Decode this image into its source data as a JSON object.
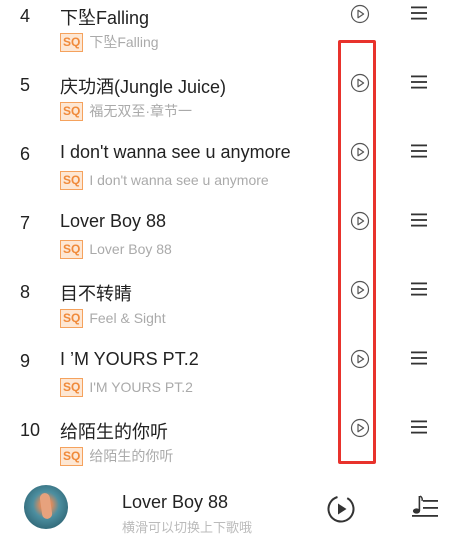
{
  "songs": [
    {
      "num": "4",
      "title": "下坠Falling",
      "quality": "SQ",
      "artist": "下坠Falling"
    },
    {
      "num": "5",
      "title": "庆功酒(Jungle Juice)",
      "quality": "SQ",
      "artist": "福无双至·章节一"
    },
    {
      "num": "6",
      "title": "I don't wanna see u anymore",
      "quality": "SQ",
      "artist": "I don't wanna see u anymore"
    },
    {
      "num": "7",
      "title": "Lover Boy 88",
      "quality": "SQ",
      "artist": "Lover Boy 88"
    },
    {
      "num": "8",
      "title": "目不转睛",
      "quality": "SQ",
      "artist": "Feel & Sight"
    },
    {
      "num": "9",
      "title": "I ’M YOURS PT.2",
      "quality": "SQ",
      "artist": "I'M YOURS PT.2"
    },
    {
      "num": "10",
      "title": "给陌生的你听",
      "quality": "SQ",
      "artist": "给陌生的你听"
    }
  ],
  "player": {
    "title": "Lover Boy 88",
    "hint": "横滑可以切换上下歌哦"
  },
  "icons": {
    "row_play": "play-circle-icon",
    "row_menu": "menu-icon",
    "player_play": "play-circle-progress-icon",
    "queue": "playlist-music-icon"
  },
  "colors": {
    "quality_badge": "#f08a3a",
    "highlight_box": "#e8322c"
  }
}
